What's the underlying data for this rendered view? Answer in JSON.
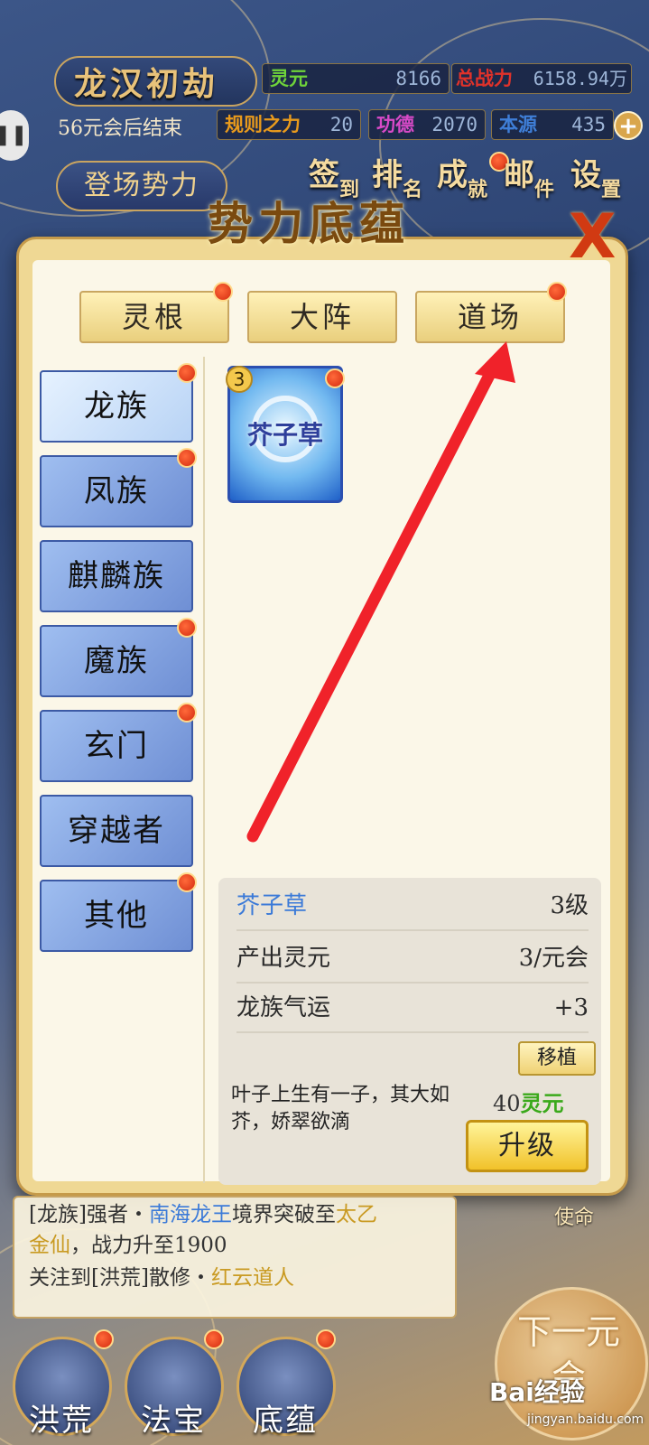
{
  "header": {
    "title": "龙汉初劫",
    "time_info": "56元会后结束",
    "pause_icon": "pause-icon",
    "stats": [
      {
        "label": "灵元",
        "value": "8166",
        "label_color": "#6fd43a"
      },
      {
        "label": "总战力",
        "value": "6158.94万",
        "label_color": "#e0322a"
      },
      {
        "label": "规则之力",
        "value": "20",
        "label_color": "#e89a1c"
      },
      {
        "label": "功德",
        "value": "2070",
        "label_color": "#d84ac8"
      },
      {
        "label": "本源",
        "value": "435",
        "label_color": "#3f7fd8"
      }
    ],
    "plus_label": "+",
    "nav_label": "登场势力",
    "buttons": [
      {
        "big": "签",
        "small": "到"
      },
      {
        "big": "排",
        "small": "名"
      },
      {
        "big": "成",
        "small": "就"
      },
      {
        "big": "邮",
        "small": "件"
      },
      {
        "big": "设",
        "small": "置"
      }
    ]
  },
  "modal": {
    "title": "势力底蕴",
    "close_label": "X",
    "tabs": [
      "灵根",
      "大阵",
      "道场"
    ],
    "categories": [
      "龙族",
      "凤族",
      "麒麟族",
      "魔族",
      "玄门",
      "穿越者",
      "其他"
    ],
    "card": {
      "name": "芥子草",
      "level": "3"
    },
    "detail": {
      "name": "芥子草",
      "level": "3级",
      "rows": [
        {
          "label": "产出灵元",
          "value": "3/元会"
        },
        {
          "label": "龙族气运",
          "value": "+3"
        }
      ],
      "move_label": "移植",
      "description": "叶子上生有一子，其大如芥，娇翠欲滴",
      "cost_value": "40",
      "cost_unit": "灵元",
      "upgrade_label": "升级"
    }
  },
  "log": {
    "line1": [
      "[龙族]强者・",
      "南海龙王",
      "境界突破至",
      "太乙"
    ],
    "line2": [
      "金仙",
      "，战力升至1900"
    ],
    "line3": [
      "关注到[洪荒]散修・",
      "红云道人"
    ]
  },
  "bottom_nav": [
    "洪荒",
    "法宝",
    "底蕴"
  ],
  "next_button": "下一元会",
  "side_tag": "使命",
  "watermark": {
    "brand": "Bai经验",
    "url": "jingyan.baidu.com"
  }
}
